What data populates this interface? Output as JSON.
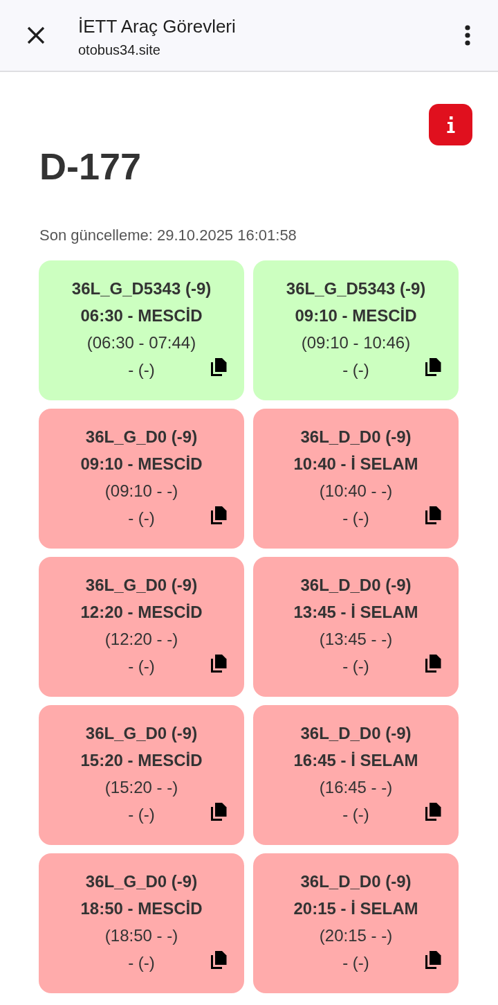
{
  "browser_bar": {
    "title": "İETT Araç Görevleri",
    "url": "otobus34.site"
  },
  "page": {
    "title": "D-177",
    "last_updated": "Son güncelleme: 29.10.2025 16:01:58"
  },
  "trips": [
    {
      "code": "36L_G_D5343 (-9)",
      "departure": "06:30 - MESCİD",
      "time_range": "(06:30 - 07:44)",
      "note": "- (-)",
      "color": "#ccffc0"
    },
    {
      "code": "36L_G_D5343 (-9)",
      "departure": "09:10 - MESCİD",
      "time_range": "(09:10 - 10:46)",
      "note": "- (-)",
      "color": "#ccffc0"
    },
    {
      "code": "36L_G_D0 (-9)",
      "departure": "09:10 - MESCİD",
      "time_range": "(09:10 - -)",
      "note": "- (-)",
      "color": "#ffabab"
    },
    {
      "code": "36L_D_D0 (-9)",
      "departure": "10:40 - İ SELAM",
      "time_range": "(10:40 - -)",
      "note": "- (-)",
      "color": "#ffabab"
    },
    {
      "code": "36L_G_D0 (-9)",
      "departure": "12:20 - MESCİD",
      "time_range": "(12:20 - -)",
      "note": "- (-)",
      "color": "#ffabab"
    },
    {
      "code": "36L_D_D0 (-9)",
      "departure": "13:45 - İ SELAM",
      "time_range": "(13:45 - -)",
      "note": "- (-)",
      "color": "#ffabab"
    },
    {
      "code": "36L_G_D0 (-9)",
      "departure": "15:20 - MESCİD",
      "time_range": "(15:20 - -)",
      "note": "- (-)",
      "color": "#ffabab"
    },
    {
      "code": "36L_D_D0 (-9)",
      "departure": "16:45 - İ SELAM",
      "time_range": "(16:45 - -)",
      "note": "- (-)",
      "color": "#ffabab"
    },
    {
      "code": "36L_G_D0 (-9)",
      "departure": "18:50 - MESCİD",
      "time_range": "(18:50 - -)",
      "note": "- (-)",
      "color": "#ffabab"
    },
    {
      "code": "36L_D_D0 (-9)",
      "departure": "20:15 - İ SELAM",
      "time_range": "(20:15 - -)",
      "note": "- (-)",
      "color": "#ffabab"
    }
  ]
}
